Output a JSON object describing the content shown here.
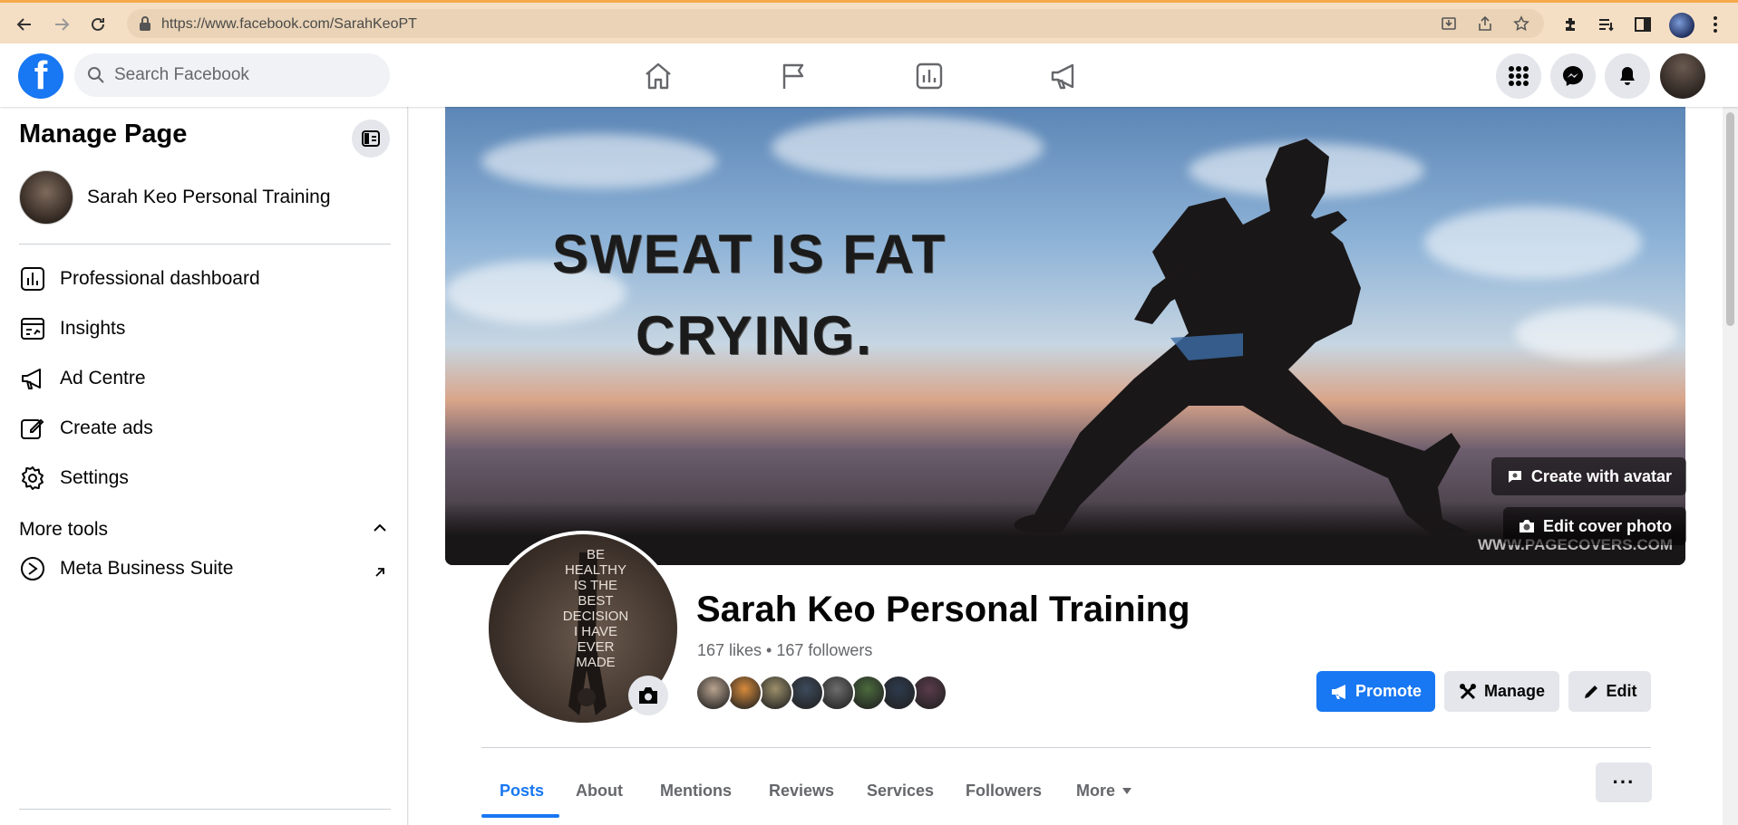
{
  "browser": {
    "url": "https://www.facebook.com/SarahKeoPT"
  },
  "header": {
    "logo": "f",
    "search_placeholder": "Search Facebook",
    "nav_icons": [
      "home-icon",
      "flag-icon",
      "dashboard-icon",
      "megaphone-icon"
    ],
    "right_icons": [
      "menu-grid-icon",
      "messenger-icon",
      "bell-icon"
    ]
  },
  "sidebar": {
    "title": "Manage Page",
    "page_name": "Sarah Keo Personal Training",
    "items": [
      {
        "label": "Professional dashboard",
        "icon": "dashboard-icon"
      },
      {
        "label": "Insights",
        "icon": "insights-icon"
      },
      {
        "label": "Ad Centre",
        "icon": "megaphone-icon"
      },
      {
        "label": "Create ads",
        "icon": "edit-icon"
      },
      {
        "label": "Settings",
        "icon": "gear-icon"
      }
    ],
    "more_tools": "More tools",
    "meta_business": "Meta Business Suite"
  },
  "cover": {
    "line1": "SWEAT IS FAT",
    "line2": "CRYING.",
    "watermark": "WWW.PAGECOVERS.COM",
    "create_avatar": "Create with avatar",
    "edit_cover": "Edit cover photo"
  },
  "profile": {
    "pic_text": "BE HEALTHY IS THE BEST DECISION I HAVE EVER MADE",
    "name": "Sarah Keo Personal Training",
    "stats": "167 likes • 167 followers",
    "fan_colors": [
      "#b9a38f",
      "#d78b3c",
      "#9c8f6a",
      "#3d4a5c",
      "#6d6d6d",
      "#4b6b3d",
      "#2d3a4e",
      "#5a3b4a"
    ]
  },
  "actions": {
    "promote": "Promote",
    "manage": "Manage",
    "edit": "Edit"
  },
  "tabs": [
    "Posts",
    "About",
    "Mentions",
    "Reviews",
    "Services",
    "Followers",
    "More"
  ],
  "more_dots": "···",
  "colors": {
    "accent": "#1877f2"
  }
}
